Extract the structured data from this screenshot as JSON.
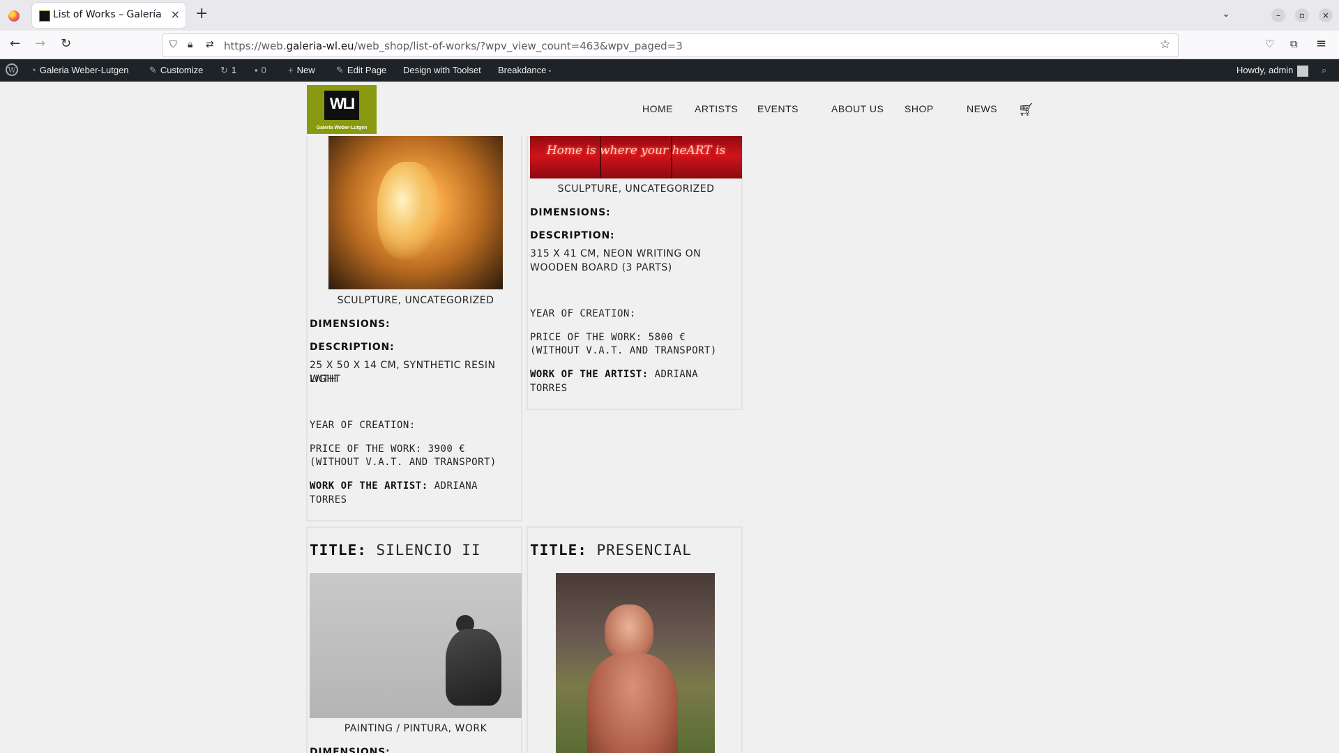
{
  "browser": {
    "tab_title": "List of Works – Galería W",
    "url_prefix": "https://web.",
    "url_domain": "galeria-wl.eu",
    "url_path": "/web_shop/list-of-works/?wpv_view_count=463&wpv_paged=3"
  },
  "admin_bar": {
    "site_name": "Galeria Weber-Lutgen",
    "customize": "Customize",
    "updates": "1",
    "comments": "0",
    "new": "New",
    "edit_page": "Edit Page",
    "toolset": "Design with Toolset",
    "breakdance": "Breakdance",
    "breakdance_dot": "•",
    "howdy": "Howdy, admin"
  },
  "logo": {
    "mark": "WLI",
    "caption": "Galería Weber-Lutgen"
  },
  "nav": {
    "items": [
      "HOME",
      "ARTISTS",
      "EVENTS",
      "ABOUT US",
      "SHOP",
      "NEWS"
    ]
  },
  "works": [
    {
      "categories": "SCULPTURE, UNCATEGORIZED",
      "dimensions_label": "DIMENSIONS:",
      "description_label": "DESCRIPTION:",
      "description_line1": "25 X 50 X 14 CM, SYNTHETIC RESIN WITH",
      "description_line2": "LIGHT",
      "year_label": "YEAR OF CREATION:",
      "price_line1": "PRICE OF THE WORK: 3900 €",
      "price_line2": "(WITHOUT V.A.T. AND TRANSPORT)",
      "artist_label": "WORK OF THE ARTIST:",
      "artist_line1": "ADRIANA",
      "artist_line2": "TORRES"
    },
    {
      "neon_text": "Home is where your heART is",
      "categories": "SCULPTURE, UNCATEGORIZED",
      "dimensions_label": "DIMENSIONS:",
      "description_label": "DESCRIPTION:",
      "description_line1": "315 X 41 CM, NEON WRITING ON",
      "description_line2": "WOODEN BOARD (3 PARTS)",
      "year_label": "YEAR OF CREATION:",
      "price_line1": "PRICE OF THE WORK: 5800 €",
      "price_line2": "(WITHOUT V.A.T. AND TRANSPORT)",
      "artist_label": "WORK OF THE ARTIST:",
      "artist_line1": "ADRIANA",
      "artist_line2": "TORRES"
    },
    {
      "title_label": "TITLE:",
      "title": "SILENCIO II",
      "categories": "PAINTING / PINTURA, WORK",
      "dimensions_label": "DIMENSIONS:"
    },
    {
      "title_label": "TITLE:",
      "title": "PRESENCIAL"
    }
  ],
  "colors": {
    "brand": "#8a9a10",
    "admin_bar": "#1d2327",
    "neon_bg": "#c4121a"
  }
}
